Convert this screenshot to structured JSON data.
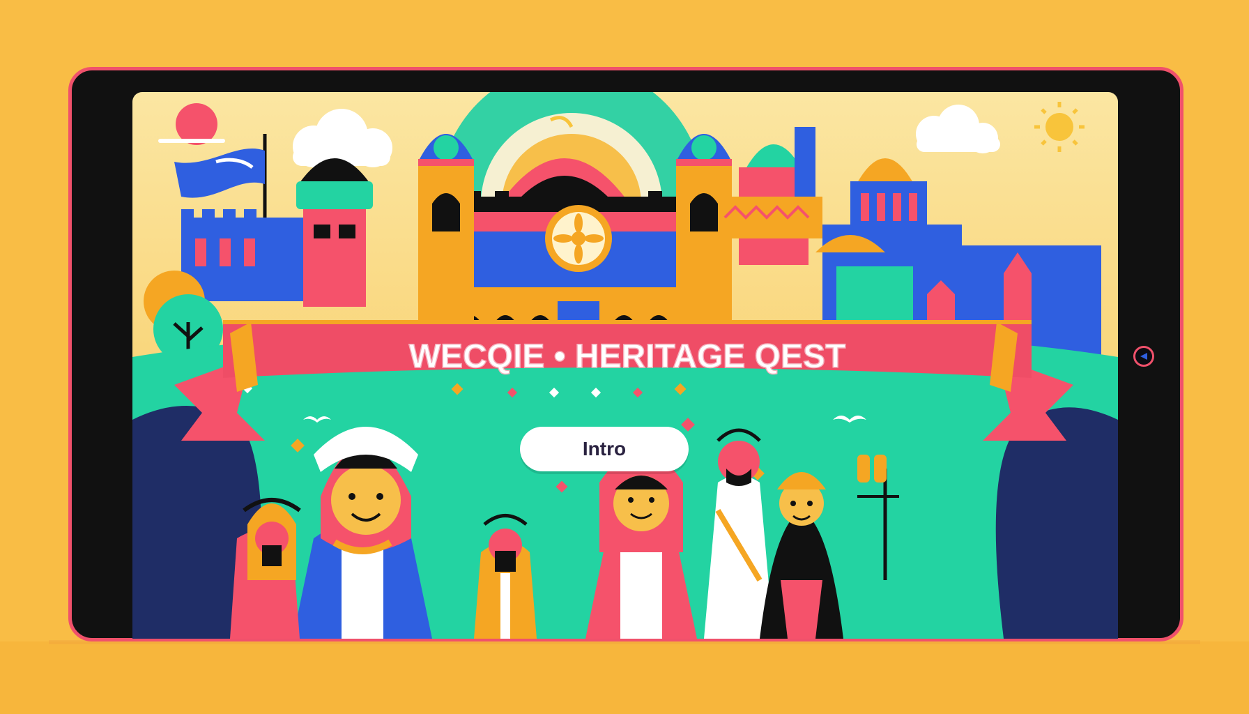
{
  "game": {
    "title_banner": "WECQIE • HERITAGE QEST",
    "intro_button": "Intro"
  },
  "device": {
    "home_button_icon": "play-triangle-icon"
  },
  "colors": {
    "background": "#f9bd45",
    "frame": "#f0516b",
    "banner": "#ef4d66",
    "teal": "#23d3a2",
    "blue": "#2f5fe0",
    "orange": "#f5a623"
  }
}
